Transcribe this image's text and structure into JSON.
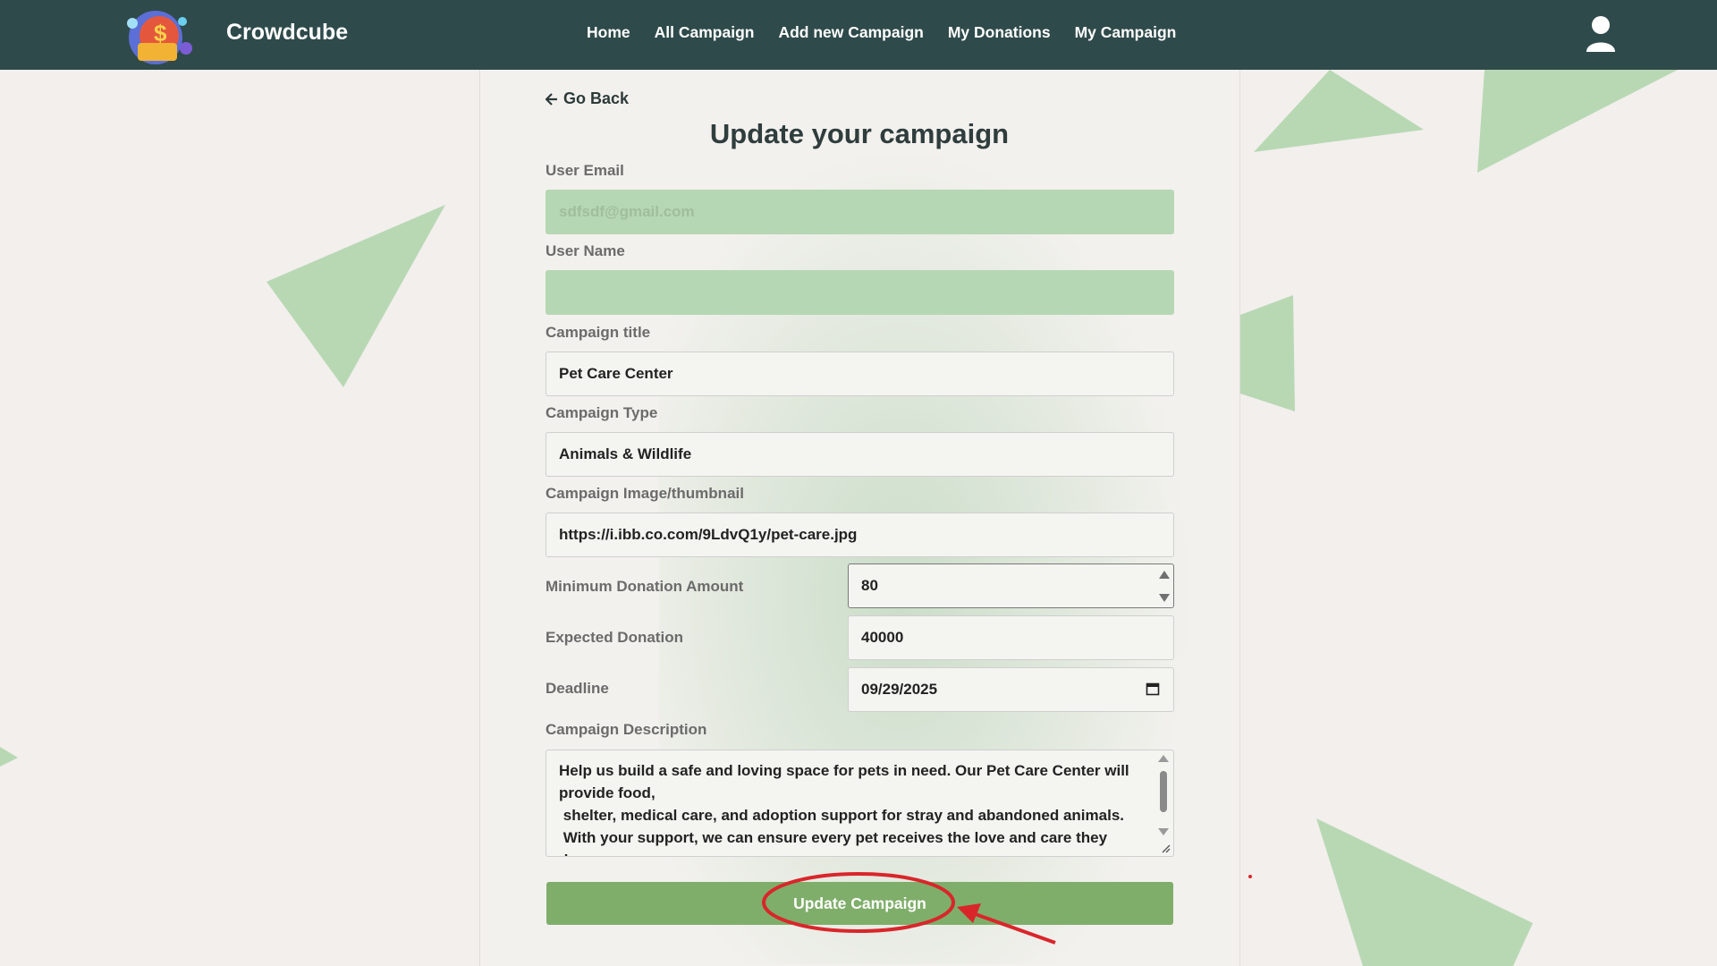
{
  "navbar": {
    "brand": "Crowdcube",
    "links": [
      "Home",
      "All Campaign",
      "Add new Campaign",
      "My Donations",
      "My Campaign"
    ]
  },
  "form": {
    "go_back": "Go Back",
    "title": "Update your campaign",
    "user_email": {
      "label": "User Email",
      "placeholder": "sdfsdf@gmail.com",
      "value": ""
    },
    "user_name": {
      "label": "User Name",
      "value": ""
    },
    "campaign_title": {
      "label": "Campaign title",
      "value": "Pet Care Center"
    },
    "campaign_type": {
      "label": "Campaign Type",
      "value": "Animals & Wildlife"
    },
    "campaign_image": {
      "label": "Campaign Image/thumbnail",
      "value": "https://i.ibb.co.com/9LdvQ1y/pet-care.jpg"
    },
    "min_donation": {
      "label": "Minimum Donation Amount",
      "value": "80"
    },
    "expected_donation": {
      "label": "Expected Donation",
      "value": "40000"
    },
    "deadline": {
      "label": "Deadline",
      "value": "09/29/2025"
    },
    "description": {
      "label": "Campaign Description",
      "value": "Help us build a safe and loving space for pets in need. Our Pet Care Center will provide food,\n shelter, medical care, and adoption support for stray and abandoned animals.\n With your support, we can ensure every pet receives the love and care they deserve"
    },
    "submit_label": "Update Campaign"
  },
  "colors": {
    "navbar": "#2f4a4a",
    "accent_green": "#7fae6a",
    "readonly_field": "#b6d7b3",
    "annotation_red": "#d9262b"
  },
  "icons": [
    "user-icon",
    "arrow-left-icon",
    "calendar-icon",
    "spinner-icon"
  ]
}
